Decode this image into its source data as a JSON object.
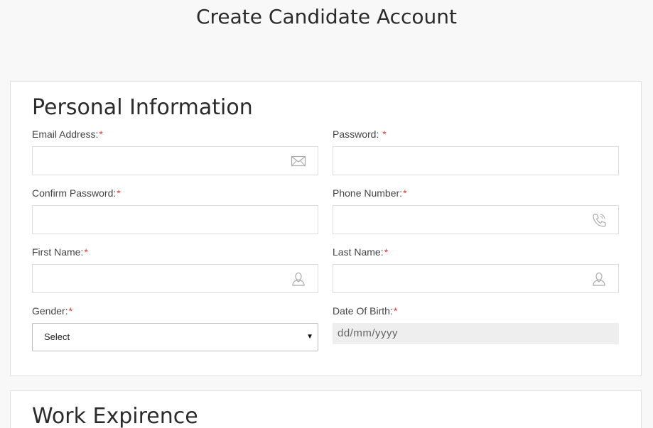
{
  "page_title": "Create Candidate Account",
  "personal": {
    "title": "Personal Information",
    "email": {
      "label": "Email Address:",
      "required": "*",
      "value": "",
      "icon": "envelope-icon"
    },
    "password": {
      "label": "Password: ",
      "required": "*",
      "value": ""
    },
    "confirm_password": {
      "label": "Confirm Password:",
      "required": "*",
      "value": ""
    },
    "phone": {
      "label": "Phone Number:",
      "required": "*",
      "value": "",
      "icon": "phone-icon"
    },
    "first_name": {
      "label": "First Name:",
      "required": "*",
      "value": "",
      "icon": "user-icon"
    },
    "last_name": {
      "label": "Last Name:",
      "required": "*",
      "value": "",
      "icon": "user-icon"
    },
    "gender": {
      "label": "Gender:",
      "required": "*",
      "selected": "Select",
      "caret": "▼"
    },
    "dob": {
      "label": "Date Of Birth:",
      "required": "*",
      "placeholder": "dd/mm/yyyy"
    }
  },
  "work": {
    "title": "Work Expirence"
  },
  "colors": {
    "required": "#e53935",
    "border": "#dddddd",
    "date_bg": "#eeeeee"
  }
}
